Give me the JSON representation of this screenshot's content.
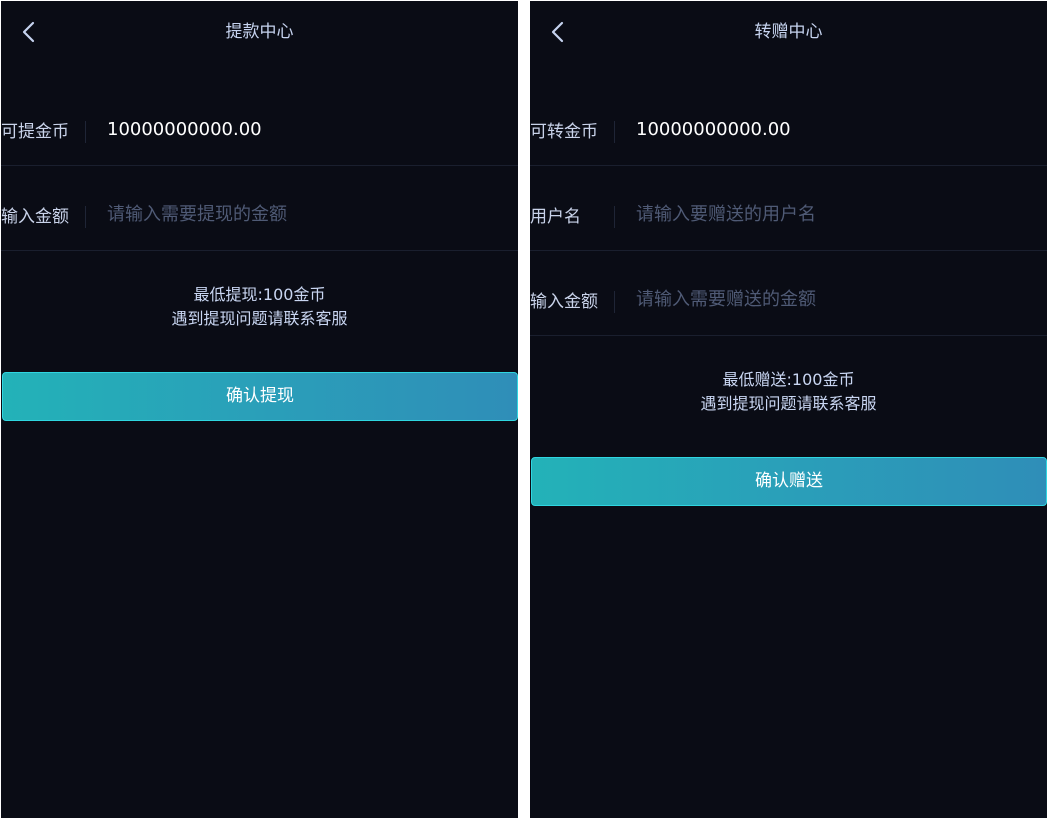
{
  "withdraw": {
    "title": "提款中心",
    "available_label": "可提金币",
    "available_value": "10000000000.00",
    "amount_label": "输入金额",
    "amount_placeholder": "请输入需要提现的金额",
    "notice_min": "最低提现:100金币",
    "notice_help": "遇到提现问题请联系客服",
    "confirm_label": "确认提现"
  },
  "transfer": {
    "title": "转赠中心",
    "available_label": "可转金币",
    "available_value": "10000000000.00",
    "username_label": "用户名",
    "username_placeholder": "请输入要赠送的用户名",
    "amount_label": "输入金额",
    "amount_placeholder": "请输入需要赠送的金额",
    "notice_min": "最低赠送:100金币",
    "notice_help": "遇到提现问题请联系客服",
    "confirm_label": "确认赠送"
  },
  "icons": {
    "back": "chevron-left-icon"
  },
  "colors": {
    "background": "#0a0c15",
    "button_start": "#23b2b8",
    "button_end": "#2f8eb8",
    "button_border": "#2fd6e0",
    "placeholder": "#4f5a75"
  }
}
